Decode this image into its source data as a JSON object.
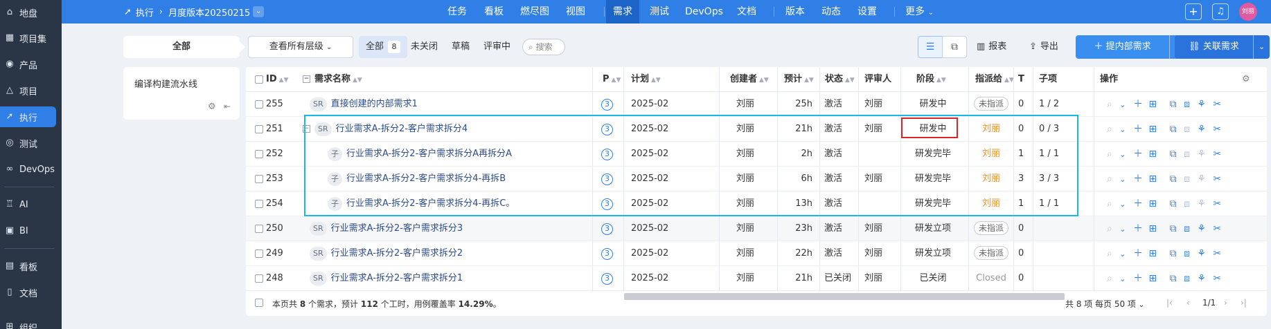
{
  "sidebar": {
    "items": [
      {
        "label": "地盘",
        "icon": "home-icon"
      },
      {
        "label": "项目集",
        "icon": "grid-icon"
      },
      {
        "label": "产品",
        "icon": "location-icon"
      },
      {
        "label": "项目",
        "icon": "flask-icon"
      },
      {
        "label": "执行",
        "icon": "rocket-icon"
      },
      {
        "label": "测试",
        "icon": "magnifier-icon"
      },
      {
        "label": "DevOps",
        "icon": "infinity-icon"
      },
      {
        "label": "AI",
        "icon": "robot-icon"
      },
      {
        "label": "BI",
        "icon": "chart-icon"
      },
      {
        "label": "看板",
        "icon": "board-icon"
      },
      {
        "label": "文档",
        "icon": "doc-icon"
      },
      {
        "label": "组织",
        "icon": "org-icon"
      }
    ]
  },
  "topbar": {
    "module": "执行",
    "version": "月度版本20250215",
    "nav": [
      "任务",
      "看板",
      "燃尽图",
      "视图",
      "需求",
      "测试",
      "DevOps",
      "文档",
      "版本",
      "动态",
      "设置",
      "更多"
    ],
    "active_nav": "需求",
    "avatar": "刘丽"
  },
  "left": {
    "tab_all": "全部",
    "pipeline": "编译构建流水线"
  },
  "filter": {
    "level": "查看所有层级",
    "tabs": [
      {
        "label": "全部",
        "count": "8"
      },
      {
        "label": "未关闭"
      },
      {
        "label": "草稿"
      },
      {
        "label": "评审中"
      }
    ],
    "search": "搜索"
  },
  "toolbar": {
    "report": "报表",
    "export": "导出",
    "create": "提内部需求",
    "link": "关联需求"
  },
  "table": {
    "columns": [
      "ID",
      "需求名称",
      "P",
      "计划",
      "创建者",
      "预计",
      "状态",
      "评审人",
      "阶段",
      "指派给",
      "T",
      "子项",
      "操作"
    ],
    "rows": [
      {
        "id": "255",
        "tag": "SR",
        "name": "直接创建的内部需求1",
        "p": "3",
        "plan": "2025-02",
        "creator": "刘丽",
        "est": "25h",
        "status": "激活",
        "reviewer": "刘丽",
        "stage": "研发中",
        "assignee": "未指派",
        "t": "0",
        "sub": "1 / 2"
      },
      {
        "id": "251",
        "tag": "SR",
        "name": "行业需求A-拆分2-客户需求拆分4",
        "p": "3",
        "plan": "2025-02",
        "creator": "刘丽",
        "est": "21h",
        "status": "激活",
        "reviewer": "刘丽",
        "stage": "研发中",
        "assignee": "刘丽",
        "t": "0",
        "sub": "0 / 3"
      },
      {
        "id": "252",
        "tag": "子",
        "name": "行业需求A-拆分2-客户需求拆分A再拆分A",
        "p": "3",
        "plan": "2025-02",
        "creator": "刘丽",
        "est": "2h",
        "status": "激活",
        "reviewer": "",
        "stage": "研发完毕",
        "assignee": "刘丽",
        "t": "1",
        "sub": "1 / 1"
      },
      {
        "id": "253",
        "tag": "子",
        "name": "行业需求A-拆分2-客户需求拆分4-再拆B",
        "p": "3",
        "plan": "2025-02",
        "creator": "刘丽",
        "est": "6h",
        "status": "激活",
        "reviewer": "刘丽",
        "stage": "研发完毕",
        "assignee": "刘丽",
        "t": "3",
        "sub": "3 / 3"
      },
      {
        "id": "254",
        "tag": "子",
        "name": "行业需求A-拆分2-客户需求拆分4-再拆C。",
        "p": "3",
        "plan": "2025-02",
        "creator": "刘丽",
        "est": "13h",
        "status": "激活",
        "reviewer": "",
        "stage": "研发完毕",
        "assignee": "刘丽",
        "t": "1",
        "sub": "1 / 1"
      },
      {
        "id": "250",
        "tag": "SR",
        "name": "行业需求A-拆分2-客户需求拆分3",
        "p": "3",
        "plan": "2025-02",
        "creator": "刘丽",
        "est": "23h",
        "status": "激活",
        "reviewer": "刘丽",
        "stage": "研发立项",
        "assignee": "未指派",
        "t": "0",
        "sub": ""
      },
      {
        "id": "249",
        "tag": "SR",
        "name": "行业需求A-拆分2-客户需求拆分2",
        "p": "3",
        "plan": "2025-02",
        "creator": "刘丽",
        "est": "22h",
        "status": "激活",
        "reviewer": "刘丽",
        "stage": "研发立项",
        "assignee": "未指派",
        "t": "0",
        "sub": ""
      },
      {
        "id": "248",
        "tag": "SR",
        "name": "行业需求A-拆分2-客户需求拆分1",
        "p": "3",
        "plan": "2025-02",
        "creator": "刘丽",
        "est": "21h",
        "status": "已关闭",
        "reviewer": "刘丽",
        "stage": "已关闭",
        "assignee": "Closed",
        "t": "0",
        "sub": ""
      }
    ]
  },
  "footer": {
    "summary_pre": "本页共",
    "summary_count": "8",
    "summary_mid": "个需求，预计",
    "summary_hours": "112",
    "summary_mid2": "个工时，用例覆盖率",
    "summary_rate": "14.29%",
    "summary_end": "。",
    "total": "共 8 项",
    "per_page": "每页 50 项",
    "page": "1/1"
  }
}
